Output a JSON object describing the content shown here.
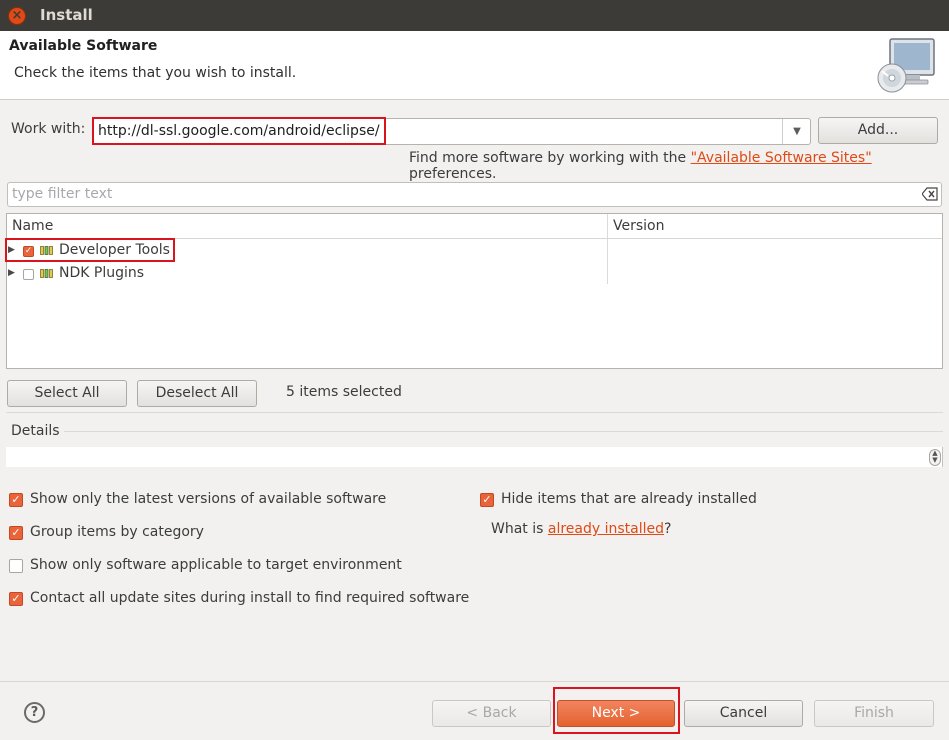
{
  "window": {
    "title": "Install",
    "close_icon": "close-icon"
  },
  "header": {
    "title": "Available Software",
    "subtitle": "Check the items that you wish to install.",
    "icon": "monitor-cd-icon"
  },
  "work_with": {
    "label": "Work with:",
    "value": "http://dl-ssl.google.com/android/eclipse/",
    "add_label": "Add...",
    "find_more_prefix": "Find more software by working with the ",
    "find_more_link": "\"Available Software Sites\"",
    "find_more_suffix": " preferences."
  },
  "filter": {
    "placeholder": "type filter text"
  },
  "table": {
    "columns": [
      "Name",
      "Version"
    ],
    "rows": [
      {
        "name": "Developer Tools",
        "version": "",
        "checked": true
      },
      {
        "name": "NDK Plugins",
        "version": "",
        "checked": false
      }
    ]
  },
  "selection": {
    "select_all": "Select All",
    "deselect_all": "Deselect All",
    "status": "5 items selected"
  },
  "details": {
    "label": "Details"
  },
  "options": {
    "latest_versions": {
      "label": "Show only the latest versions of available software",
      "checked": true
    },
    "group_by_category": {
      "label": "Group items by category",
      "checked": true
    },
    "target_env": {
      "label": "Show only software applicable to target environment",
      "checked": false
    },
    "contact_sites": {
      "label": "Contact all update sites during install to find required software",
      "checked": true
    },
    "hide_installed": {
      "label": "Hide items that are already installed",
      "checked": true
    },
    "what_is_prefix": "What is ",
    "what_is_link": "already installed",
    "what_is_suffix": "?"
  },
  "footer": {
    "back": "< Back",
    "next": "Next >",
    "cancel": "Cancel",
    "finish": "Finish"
  },
  "colors": {
    "accent": "#e9643b",
    "highlight": "#d9141e",
    "titlebar": "#3c3b37"
  }
}
